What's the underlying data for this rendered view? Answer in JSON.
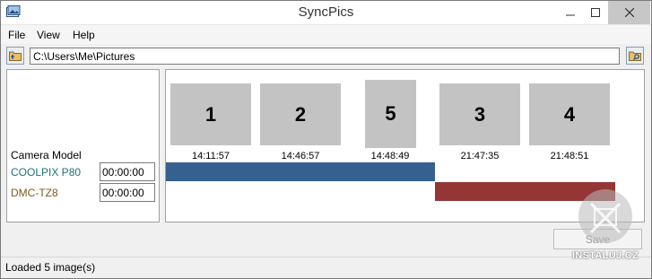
{
  "window": {
    "title": "SyncPics"
  },
  "menu": {
    "items": [
      "File",
      "View",
      "Help"
    ]
  },
  "toolbar": {
    "path_value": "C:\\Users\\Me\\Pictures"
  },
  "cameras": {
    "header": "Camera Model",
    "items": [
      {
        "name": "COOLPIX P80",
        "offset": "00:00:00",
        "color": "#1f6f7a",
        "bar_color": "#366090"
      },
      {
        "name": "DMC-TZ8",
        "offset": "00:00:00",
        "color": "#7a5a1a",
        "bar_color": "#943636"
      }
    ]
  },
  "timeline": {
    "thumbnails": [
      {
        "label": "1",
        "time": "14:11:57"
      },
      {
        "label": "2",
        "time": "14:46:57"
      },
      {
        "label": "5",
        "time": "14:48:49"
      },
      {
        "label": "3",
        "time": "21:47:35"
      },
      {
        "label": "4",
        "time": "21:48:51"
      }
    ]
  },
  "actions": {
    "save_label": "Save"
  },
  "status": {
    "text": "Loaded 5 image(s)"
  },
  "watermark": {
    "text": "INSTALUJ.CZ"
  }
}
